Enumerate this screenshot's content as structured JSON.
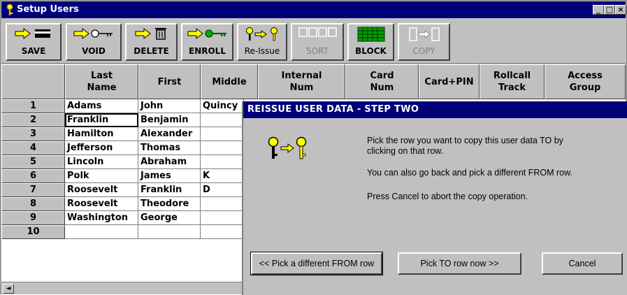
{
  "window": {
    "title": "Setup Users",
    "minimize": "_",
    "maximize": "□",
    "close": "×"
  },
  "toolbar": {
    "save": "SAVE",
    "void": "VOID",
    "delete": "DELETE",
    "enroll": "ENROLL",
    "reissue": "Re-Issue",
    "sort": "SORT",
    "block": "BLOCK",
    "copy": "COPY"
  },
  "grid": {
    "headers": [
      {
        "l1": "Last",
        "l2": "Name"
      },
      {
        "l1": "First",
        "l2": ""
      },
      {
        "l1": "Middle",
        "l2": ""
      },
      {
        "l1": "Internal",
        "l2": "Num"
      },
      {
        "l1": "Card",
        "l2": "Num"
      },
      {
        "l1": "Card+PIN",
        "l2": ""
      },
      {
        "l1": "Rollcall",
        "l2": "Track"
      },
      {
        "l1": "Access",
        "l2": "Group"
      }
    ],
    "rows": [
      {
        "num": "1",
        "last": "Adams",
        "first": "John",
        "middle": "Quincy"
      },
      {
        "num": "2",
        "last": "Franklin",
        "first": "Benjamin",
        "middle": ""
      },
      {
        "num": "3",
        "last": "Hamilton",
        "first": "Alexander",
        "middle": ""
      },
      {
        "num": "4",
        "last": "Jefferson",
        "first": "Thomas",
        "middle": ""
      },
      {
        "num": "5",
        "last": "Lincoln",
        "first": "Abraham",
        "middle": ""
      },
      {
        "num": "6",
        "last": "Polk",
        "first": "James",
        "middle": "K"
      },
      {
        "num": "7",
        "last": "Roosevelt",
        "first": "Franklin",
        "middle": "D"
      },
      {
        "num": "8",
        "last": "Roosevelt",
        "first": "Theodore",
        "middle": ""
      },
      {
        "num": "9",
        "last": "Washington",
        "first": "George",
        "middle": ""
      },
      {
        "num": "10",
        "last": "",
        "first": "",
        "middle": ""
      }
    ],
    "scroll_left": "◄"
  },
  "dialog": {
    "title": "REISSUE USER DATA - STEP TWO",
    "line1": "Pick the row you want to copy this user data TO by",
    "line2": "clicking on that row.",
    "line3": "You can also go back and pick a different FROM row.",
    "line4": "Press Cancel to abort the copy operation.",
    "btn_back": "<< Pick a different FROM row",
    "btn_pick": "Pick TO row now >>",
    "btn_cancel": "Cancel"
  },
  "colors": {
    "titlebar": "#00007b",
    "face": "#c0c0c0",
    "key_yellow": "#ffff00",
    "enroll_green": "#008000",
    "block_green": "#00a000"
  }
}
